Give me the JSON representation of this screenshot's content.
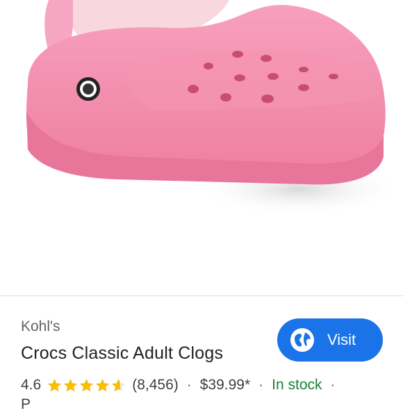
{
  "listing": {
    "store": "Kohl's",
    "title": "Crocs Classic Adult Clogs",
    "visit_label": "Visit",
    "rating": "4.6",
    "rating_value": 4.6,
    "review_count": "(8,456)",
    "separator": "·",
    "price": "$39.99*",
    "availability": "In stock",
    "cutoff_line": "P"
  },
  "colors": {
    "accent": "#1a73e8",
    "star": "#fbbc04",
    "in_stock": "#188038",
    "clog": "#f48aa9"
  },
  "icons": {
    "visit": "globe-icon",
    "rating": "star-icon"
  }
}
